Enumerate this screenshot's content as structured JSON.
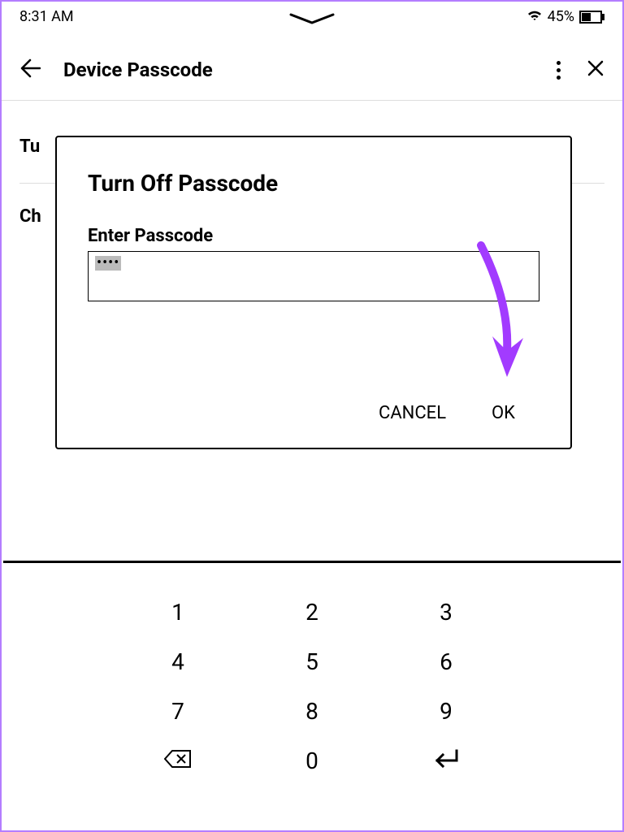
{
  "status": {
    "time": "8:31 AM",
    "battery_percent": "45%"
  },
  "header": {
    "title": "Device Passcode"
  },
  "background_list": {
    "row1": "Tu",
    "row2": "Ch"
  },
  "dialog": {
    "title": "Turn Off Passcode",
    "label": "Enter Passcode",
    "input_value": "••••",
    "buttons": {
      "cancel": "CANCEL",
      "ok": "OK"
    }
  },
  "keypad": {
    "r1": [
      "1",
      "2",
      "3"
    ],
    "r2": [
      "4",
      "5",
      "6"
    ],
    "r3": [
      "7",
      "8",
      "9"
    ],
    "r4_mid": "0"
  }
}
